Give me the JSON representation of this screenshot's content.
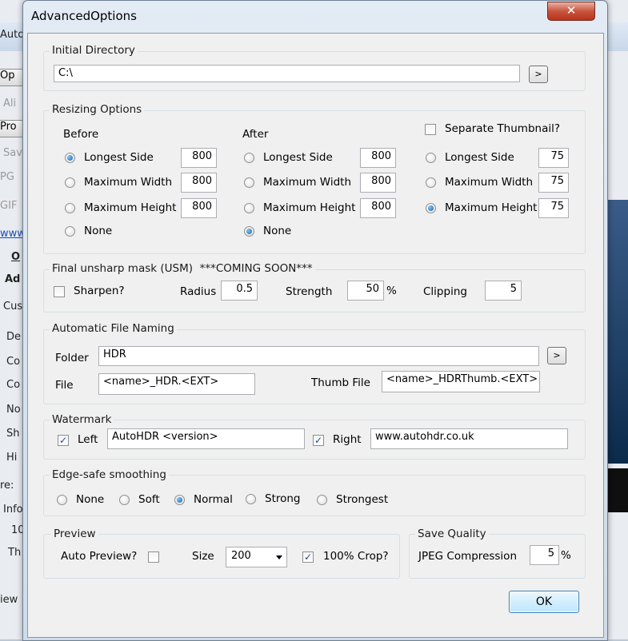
{
  "background": {
    "title_fragment": "Auto",
    "left_fragments": [
      "Op",
      "Ali",
      "Pro",
      "Sav",
      "PG",
      "GIF",
      "www.a",
      "O",
      "Ad",
      "Cus",
      "De",
      "Co",
      "Co",
      "No",
      "Sh",
      "Hi",
      "re:",
      "Info",
      "10",
      "Th",
      "iew"
    ]
  },
  "dialog": {
    "title": "AdvancedOptions",
    "close_symbol": "✕",
    "initial_directory": {
      "label": "Initial Directory",
      "value": "C:\\",
      "browse_label": ">"
    },
    "resizing": {
      "label": "Resizing Options",
      "before": {
        "heading": "Before",
        "longest_side": "Longest Side",
        "longest_value": "800",
        "max_width": "Maximum Width",
        "width_value": "800",
        "max_height": "Maximum Height",
        "height_value": "800",
        "none": "None"
      },
      "after": {
        "heading": "After",
        "longest_side": "Longest Side",
        "longest_value": "800",
        "max_width": "Maximum Width",
        "width_value": "800",
        "max_height": "Maximum Height",
        "height_value": "800",
        "none": "None"
      },
      "thumbnail": {
        "checkbox_label": "Separate Thumbnail?",
        "longest_side": "Longest Side",
        "longest_value": "75",
        "max_width": "Maximum Width",
        "width_value": "75",
        "max_height": "Maximum Height",
        "height_value": "75"
      }
    },
    "usm": {
      "label": "Final unsharp mask (USM)",
      "note": "***COMING SOON***",
      "sharpen": "Sharpen?",
      "radius_label": "Radius",
      "radius_value": "0.5",
      "strength_label": "Strength",
      "strength_value": "50",
      "strength_unit": "%",
      "clipping_label": "Clipping",
      "clipping_value": "5"
    },
    "naming": {
      "label": "Automatic File Naming",
      "folder_label": "Folder",
      "folder_value": "HDR",
      "browse_label": ">",
      "file_label": "File",
      "file_value": "<name>_HDR.<EXT>",
      "thumb_label": "Thumb File",
      "thumb_value": "<name>_HDRThumb.<EXT>"
    },
    "watermark": {
      "label": "Watermark",
      "left_label": "Left",
      "left_value": "AutoHDR <version>",
      "right_label": "Right",
      "right_value": "www.autohdr.co.uk"
    },
    "edge": {
      "label": "Edge-safe smoothing",
      "options": [
        "None",
        "Soft",
        "Normal",
        "Strong",
        "Strongest"
      ],
      "selected": "Normal"
    },
    "preview": {
      "label": "Preview",
      "auto_preview": "Auto Preview?",
      "size_label": "Size",
      "size_value": "200",
      "crop_label": "100% Crop?"
    },
    "save_quality": {
      "label": "Save Quality",
      "jpeg_label": "JPEG Compression",
      "jpeg_value": "5",
      "jpeg_unit": "%"
    },
    "ok_label": "OK"
  }
}
